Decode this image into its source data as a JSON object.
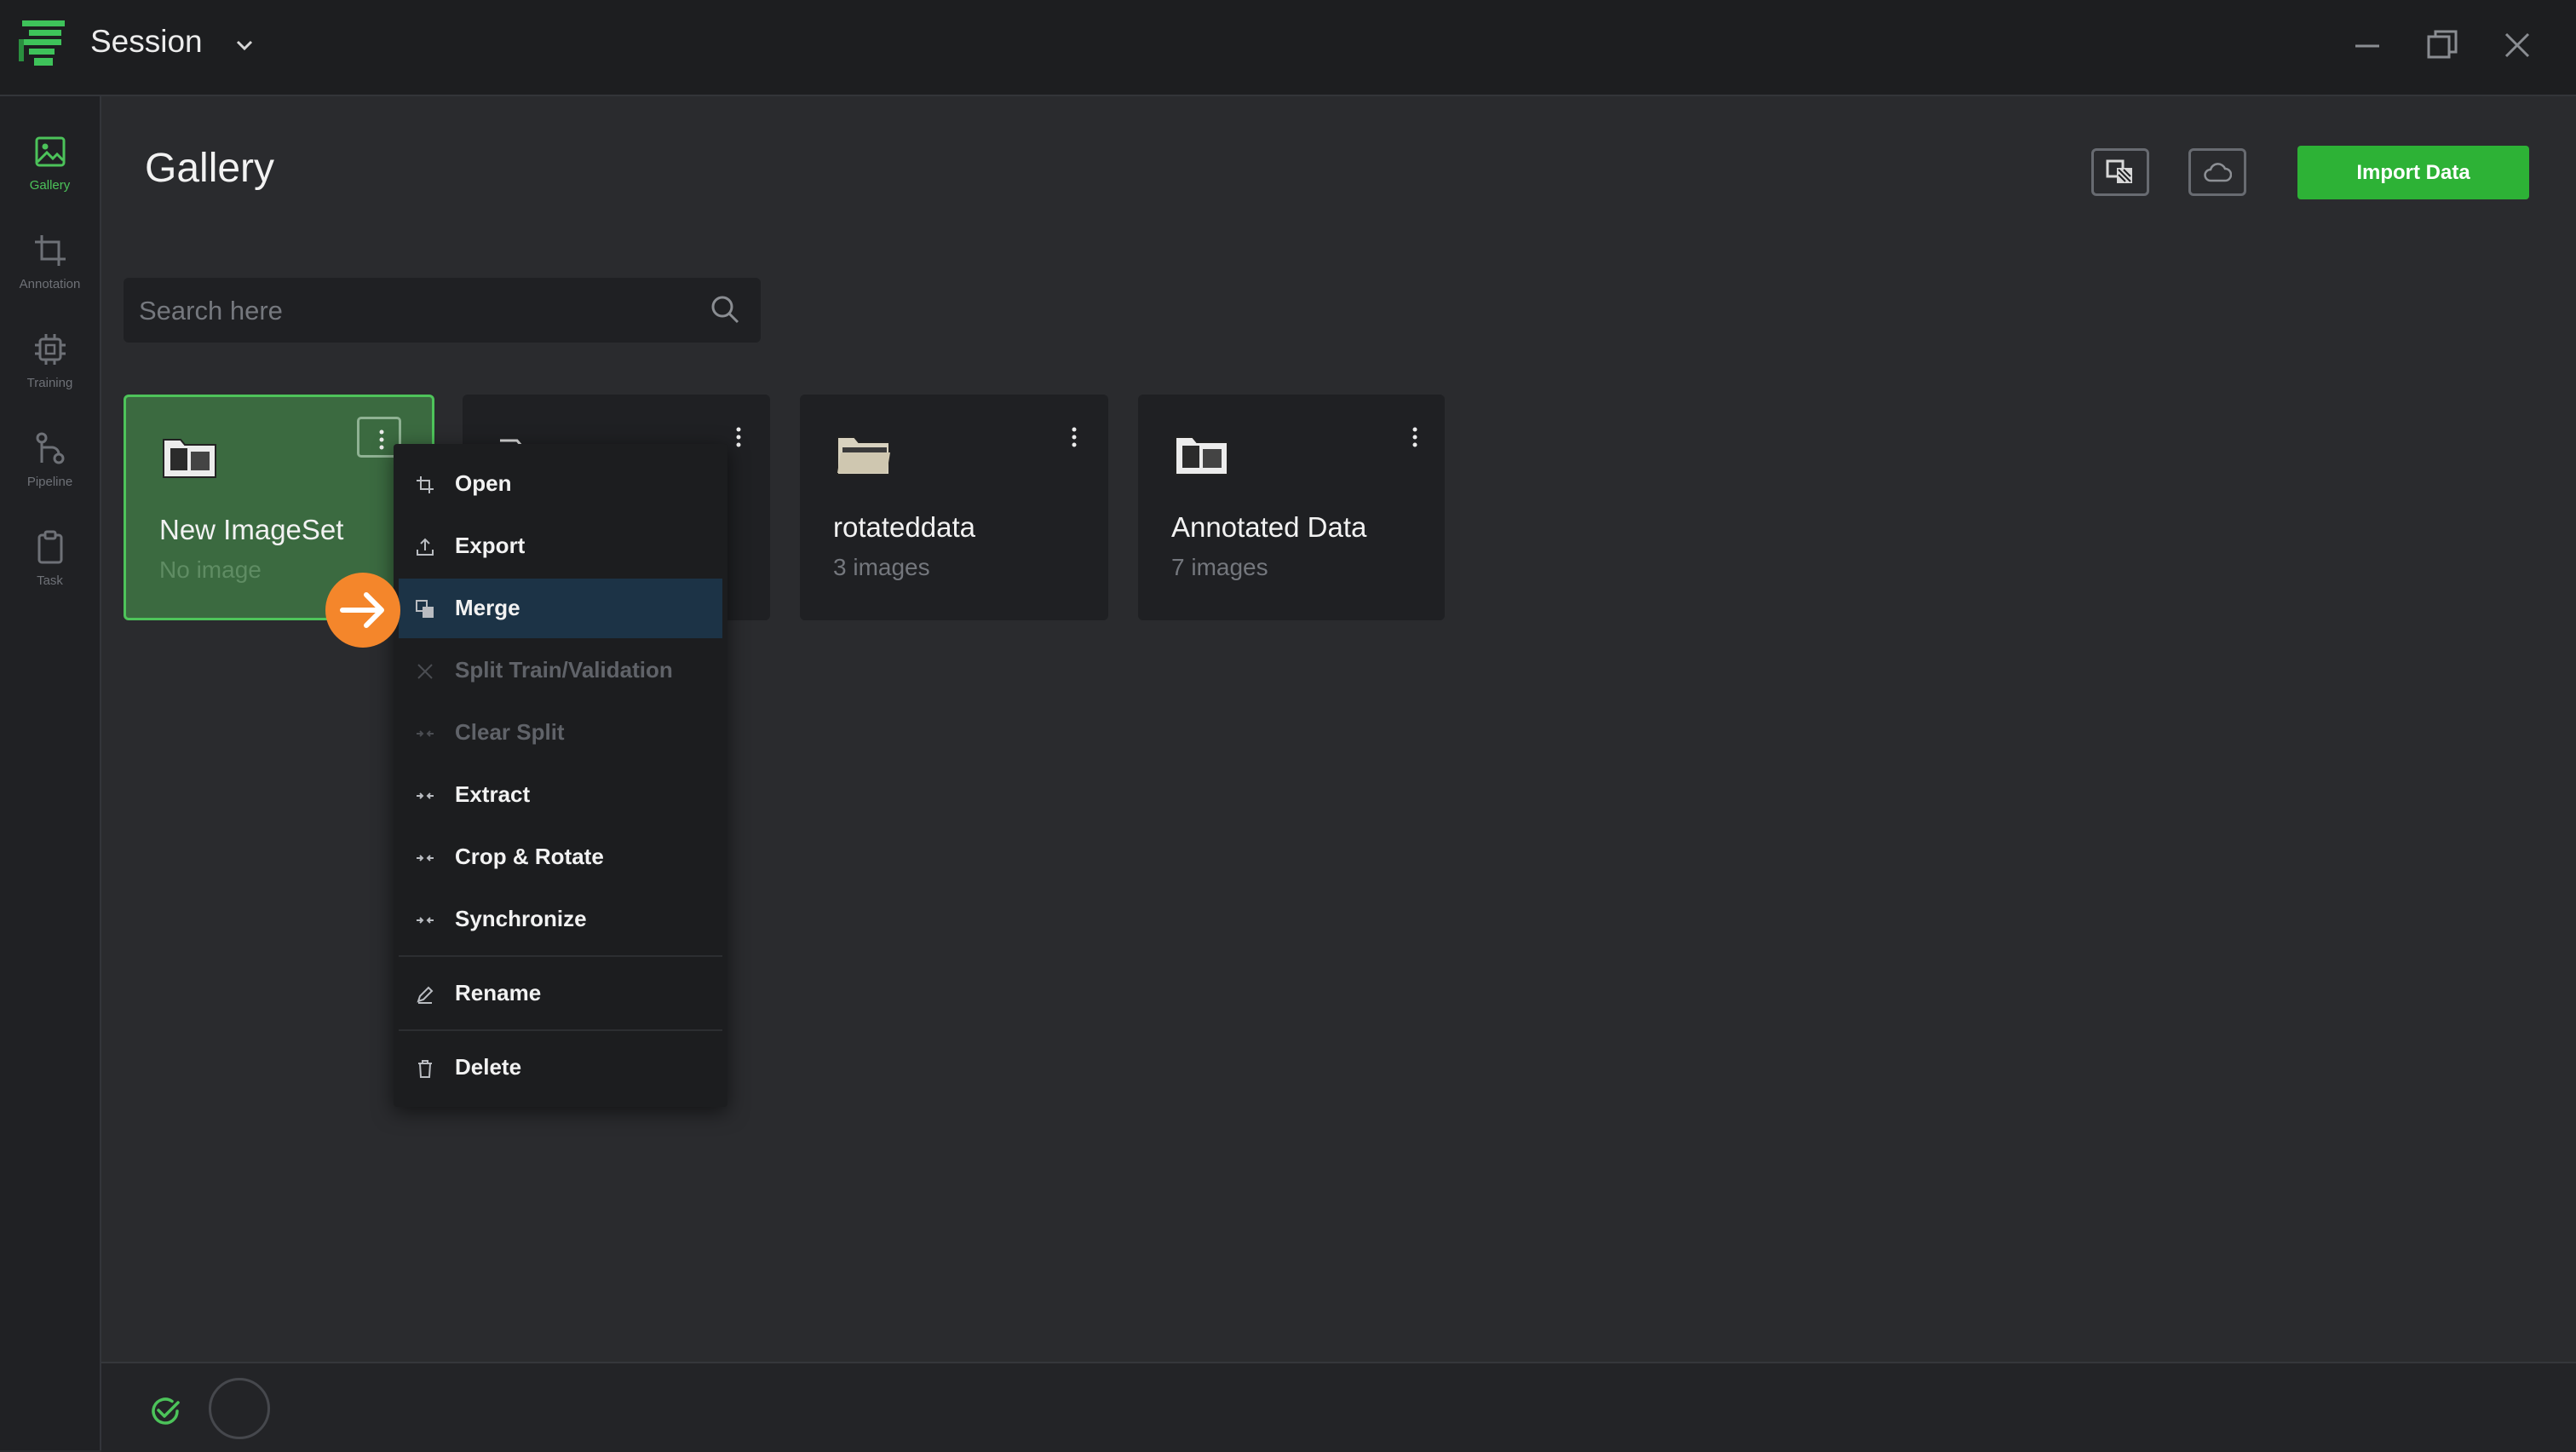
{
  "window": {
    "session_label": "Session",
    "controls": [
      "minimize-icon",
      "restore-icon",
      "close-icon"
    ]
  },
  "sidebar": {
    "items": [
      {
        "label": "Gallery",
        "icon": "image-icon",
        "active": true
      },
      {
        "label": "Annotation",
        "icon": "crop-icon",
        "active": false
      },
      {
        "label": "Training",
        "icon": "chip-icon",
        "active": false
      },
      {
        "label": "Pipeline",
        "icon": "pipeline-icon",
        "active": false
      },
      {
        "label": "Task",
        "icon": "clipboard-icon",
        "active": false
      }
    ]
  },
  "header": {
    "title": "Gallery",
    "import_label": "Import Data"
  },
  "search": {
    "placeholder": "Search here",
    "value": ""
  },
  "cards": [
    {
      "name": "New ImageSet",
      "count": "No image",
      "selected": true
    },
    {
      "name": "",
      "count": "",
      "selected": false
    },
    {
      "name": "rotateddata",
      "count": "3 images",
      "selected": false
    },
    {
      "name": "Annotated Data",
      "count": "7 images",
      "selected": false
    }
  ],
  "context_menu": {
    "items": [
      {
        "label": "Open",
        "icon": "crop-icon",
        "disabled": false
      },
      {
        "label": "Export",
        "icon": "upload-icon",
        "disabled": false
      },
      {
        "label": "Merge",
        "icon": "merge-icon",
        "disabled": false,
        "highlighted": true
      },
      {
        "label": "Split Train/Validation",
        "icon": "split-icon",
        "disabled": true
      },
      {
        "label": "Clear Split",
        "icon": "arrows-in-icon",
        "disabled": true
      },
      {
        "label": "Extract",
        "icon": "arrows-in-icon",
        "disabled": false
      },
      {
        "label": "Crop & Rotate",
        "icon": "arrows-in-icon",
        "disabled": false
      },
      {
        "label": "Synchronize",
        "icon": "arrows-in-icon",
        "disabled": false
      },
      {
        "label": "Rename",
        "icon": "pencil-icon",
        "disabled": false
      },
      {
        "label": "Delete",
        "icon": "trash-icon",
        "disabled": false
      }
    ]
  },
  "colors": {
    "accent": "#2db236",
    "highlight": "#1c3346",
    "pointer": "#f4862b",
    "background": "#2a2b2e"
  }
}
